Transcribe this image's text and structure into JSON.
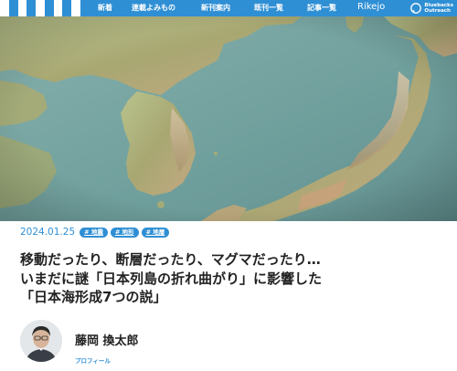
{
  "header": {
    "nav_items": [
      {
        "label": "新着"
      },
      {
        "label": "連載よみもの"
      },
      {
        "label": "新刊案内"
      },
      {
        "label": "既刊一覧"
      },
      {
        "label": "記事一覧"
      },
      {
        "label": "Rikejo"
      }
    ],
    "outreach_label": "Bluebacks\nOutreach",
    "accent_color": "#2f8fd4"
  },
  "article": {
    "date": "2024.01.25",
    "tags": [
      "# 地震",
      "# 地形",
      "# 地層"
    ],
    "title_lines": [
      "移動だったり、断層だったり、マグマだったり…",
      "いまだに謎「日本列島の折れ曲がり」に影響した",
      "「日本海形成7つの説」"
    ]
  },
  "author": {
    "name": "藤岡 換太郎",
    "profile_label": "プロフィール"
  }
}
